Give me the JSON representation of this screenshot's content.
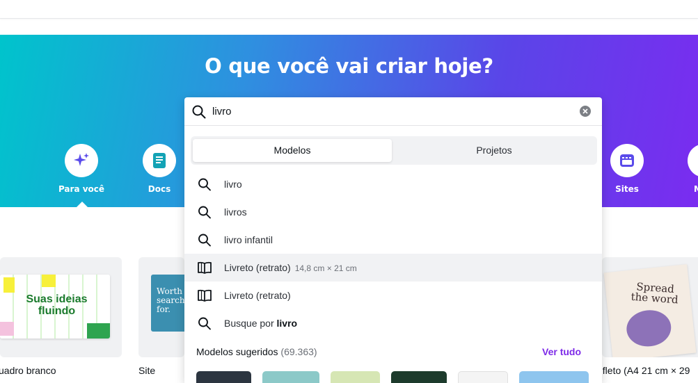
{
  "hero": {
    "title": "O que você vai criar hoje?",
    "categories": [
      {
        "label": "Para você",
        "icon": "sparkle-icon"
      },
      {
        "label": "Docs",
        "icon": "doc-icon"
      },
      {
        "label": "Sites",
        "icon": "website-icon"
      },
      {
        "label": "M",
        "icon": "more-icon"
      }
    ]
  },
  "cards": [
    {
      "label": "uadro branco",
      "preview_text": "Suas ideias fluindo"
    },
    {
      "label": "Site",
      "preview_text": "Worth searching for."
    },
    {
      "label": "nfleto (A4 21 cm × 29",
      "preview_text": "Spread the word"
    }
  ],
  "search": {
    "value": "livro",
    "tabs": [
      "Modelos",
      "Projetos"
    ],
    "active_tab": "Modelos",
    "suggestions": [
      {
        "icon": "search-icon",
        "text": "livro"
      },
      {
        "icon": "search-icon",
        "text": "livros"
      },
      {
        "icon": "search-icon",
        "text": "livro infantil"
      },
      {
        "icon": "book-icon",
        "text": "Livreto (retrato)",
        "sub": "14,8 cm × 21 cm"
      },
      {
        "icon": "book-icon",
        "text": "Livreto (retrato)"
      },
      {
        "icon": "search-icon",
        "prefix": "Busque por",
        "bold": "livro"
      }
    ],
    "suggested": {
      "label": "Modelos sugeridos",
      "count": "(69.363)",
      "see_all": "Ver tudo"
    }
  },
  "colors": {
    "accent": "#7d2ae8",
    "gradient_start": "#00c4cc",
    "gradient_end": "#7a2cf0"
  }
}
